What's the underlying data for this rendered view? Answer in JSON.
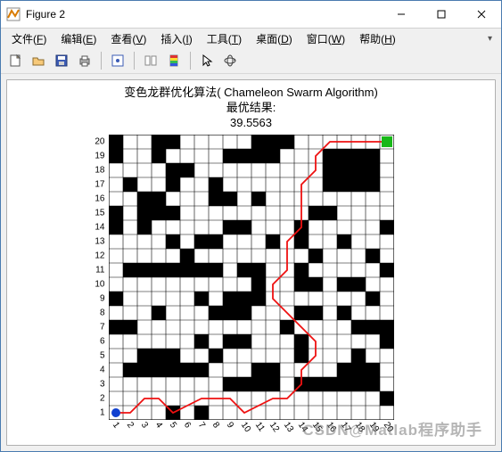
{
  "window": {
    "title": "Figure 2"
  },
  "menus": [
    {
      "label": "文件",
      "u": "F"
    },
    {
      "label": "编辑",
      "u": "E"
    },
    {
      "label": "查看",
      "u": "V"
    },
    {
      "label": "插入",
      "u": "I"
    },
    {
      "label": "工具",
      "u": "T"
    },
    {
      "label": "桌面",
      "u": "D"
    },
    {
      "label": "窗口",
      "u": "W"
    },
    {
      "label": "帮助",
      "u": "H"
    }
  ],
  "plot": {
    "title1": "变色龙群优化算法( Chameleon Swarm Algorithm)",
    "title2": "最优结果:",
    "title3": "39.5563"
  },
  "watermark": "CSDN@Matlab程序助手",
  "chart_data": {
    "type": "heatmap",
    "grid_size": 20,
    "xlabels": [
      1,
      2,
      3,
      4,
      5,
      6,
      7,
      8,
      9,
      10,
      11,
      12,
      13,
      14,
      15,
      16,
      17,
      18,
      19,
      20
    ],
    "ylabels": [
      1,
      2,
      3,
      4,
      5,
      6,
      7,
      8,
      9,
      10,
      11,
      12,
      13,
      14,
      15,
      16,
      17,
      18,
      19,
      20
    ],
    "obstacles": [
      [
        1,
        20
      ],
      [
        4,
        20
      ],
      [
        5,
        20
      ],
      [
        11,
        20
      ],
      [
        12,
        20
      ],
      [
        13,
        20
      ],
      [
        1,
        19
      ],
      [
        4,
        19
      ],
      [
        9,
        19
      ],
      [
        10,
        19
      ],
      [
        11,
        19
      ],
      [
        12,
        19
      ],
      [
        16,
        19
      ],
      [
        17,
        19
      ],
      [
        18,
        19
      ],
      [
        19,
        19
      ],
      [
        5,
        18
      ],
      [
        6,
        18
      ],
      [
        16,
        18
      ],
      [
        17,
        18
      ],
      [
        18,
        18
      ],
      [
        19,
        18
      ],
      [
        2,
        17
      ],
      [
        5,
        17
      ],
      [
        8,
        17
      ],
      [
        16,
        17
      ],
      [
        17,
        17
      ],
      [
        18,
        17
      ],
      [
        19,
        17
      ],
      [
        3,
        16
      ],
      [
        4,
        16
      ],
      [
        8,
        16
      ],
      [
        9,
        16
      ],
      [
        11,
        16
      ],
      [
        1,
        15
      ],
      [
        3,
        15
      ],
      [
        4,
        15
      ],
      [
        5,
        15
      ],
      [
        15,
        15
      ],
      [
        16,
        15
      ],
      [
        1,
        14
      ],
      [
        3,
        14
      ],
      [
        9,
        14
      ],
      [
        10,
        14
      ],
      [
        14,
        14
      ],
      [
        20,
        14
      ],
      [
        5,
        13
      ],
      [
        7,
        13
      ],
      [
        8,
        13
      ],
      [
        12,
        13
      ],
      [
        14,
        13
      ],
      [
        17,
        13
      ],
      [
        6,
        12
      ],
      [
        15,
        12
      ],
      [
        19,
        12
      ],
      [
        2,
        11
      ],
      [
        3,
        11
      ],
      [
        4,
        11
      ],
      [
        5,
        11
      ],
      [
        6,
        11
      ],
      [
        7,
        11
      ],
      [
        8,
        11
      ],
      [
        10,
        11
      ],
      [
        11,
        11
      ],
      [
        14,
        11
      ],
      [
        20,
        11
      ],
      [
        11,
        10
      ],
      [
        14,
        10
      ],
      [
        15,
        10
      ],
      [
        17,
        10
      ],
      [
        18,
        10
      ],
      [
        1,
        9
      ],
      [
        7,
        9
      ],
      [
        9,
        9
      ],
      [
        10,
        9
      ],
      [
        11,
        9
      ],
      [
        19,
        9
      ],
      [
        4,
        8
      ],
      [
        8,
        8
      ],
      [
        9,
        8
      ],
      [
        10,
        8
      ],
      [
        14,
        8
      ],
      [
        15,
        8
      ],
      [
        17,
        8
      ],
      [
        1,
        7
      ],
      [
        2,
        7
      ],
      [
        13,
        7
      ],
      [
        18,
        7
      ],
      [
        19,
        7
      ],
      [
        20,
        7
      ],
      [
        7,
        6
      ],
      [
        9,
        6
      ],
      [
        10,
        6
      ],
      [
        14,
        6
      ],
      [
        20,
        6
      ],
      [
        3,
        5
      ],
      [
        4,
        5
      ],
      [
        5,
        5
      ],
      [
        8,
        5
      ],
      [
        14,
        5
      ],
      [
        18,
        5
      ],
      [
        2,
        4
      ],
      [
        3,
        4
      ],
      [
        4,
        4
      ],
      [
        5,
        4
      ],
      [
        6,
        4
      ],
      [
        7,
        4
      ],
      [
        11,
        4
      ],
      [
        12,
        4
      ],
      [
        17,
        4
      ],
      [
        18,
        4
      ],
      [
        19,
        4
      ],
      [
        9,
        3
      ],
      [
        10,
        3
      ],
      [
        11,
        3
      ],
      [
        12,
        3
      ],
      [
        14,
        3
      ],
      [
        15,
        3
      ],
      [
        16,
        3
      ],
      [
        17,
        3
      ],
      [
        18,
        3
      ],
      [
        19,
        3
      ],
      [
        20,
        2
      ],
      [
        5,
        1
      ],
      [
        7,
        1
      ]
    ],
    "start": [
      1,
      1
    ],
    "goal": [
      20,
      20
    ],
    "path": [
      [
        1,
        1
      ],
      [
        2,
        1
      ],
      [
        2.5,
        1.5
      ],
      [
        3,
        2
      ],
      [
        4,
        2
      ],
      [
        4.5,
        1.5
      ],
      [
        5,
        1
      ],
      [
        6,
        1.5
      ],
      [
        7,
        2
      ],
      [
        8,
        2
      ],
      [
        9,
        2
      ],
      [
        9.5,
        1.5
      ],
      [
        10,
        1
      ],
      [
        11,
        1.5
      ],
      [
        12,
        2
      ],
      [
        13,
        2
      ],
      [
        13.5,
        2.5
      ],
      [
        14,
        3
      ],
      [
        14,
        4
      ],
      [
        14.5,
        4.5
      ],
      [
        15,
        5
      ],
      [
        15,
        6
      ],
      [
        14.5,
        6.5
      ],
      [
        14,
        7
      ],
      [
        13.5,
        7.5
      ],
      [
        13,
        8
      ],
      [
        12.5,
        8.5
      ],
      [
        12,
        9
      ],
      [
        12,
        10
      ],
      [
        12.5,
        10.5
      ],
      [
        13,
        11
      ],
      [
        13,
        12
      ],
      [
        13,
        13
      ],
      [
        13.5,
        13.5
      ],
      [
        14,
        14
      ],
      [
        14,
        15
      ],
      [
        14,
        16
      ],
      [
        14,
        17
      ],
      [
        14.5,
        17.5
      ],
      [
        15,
        18
      ],
      [
        15,
        19
      ],
      [
        15.5,
        19.5
      ],
      [
        16,
        20
      ],
      [
        17,
        20
      ],
      [
        18,
        20
      ],
      [
        19,
        20
      ],
      [
        20,
        20
      ]
    ],
    "colors": {
      "grid": "#000",
      "obstacle": "#000",
      "path": "#e11",
      "start": "#1040d0",
      "goal": "#18b818"
    },
    "best_result": 39.5563
  }
}
